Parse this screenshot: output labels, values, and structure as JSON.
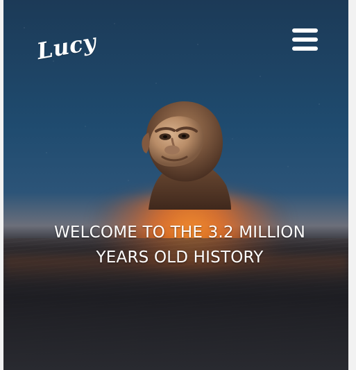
{
  "site": {
    "logo_text": "Lucy"
  },
  "hero": {
    "headline": "WELCOME TO THE 3.2 MILLION YEARS OLD HISTORY"
  },
  "icons": {
    "menu": "menu-icon"
  },
  "colors": {
    "text": "#ffffff",
    "page_background": "#f2f2f2",
    "sky_top": "#1c3a57",
    "sky_mid": "#2c5478",
    "horizon_glow": "#ff8f24",
    "ground": "#292a30"
  }
}
